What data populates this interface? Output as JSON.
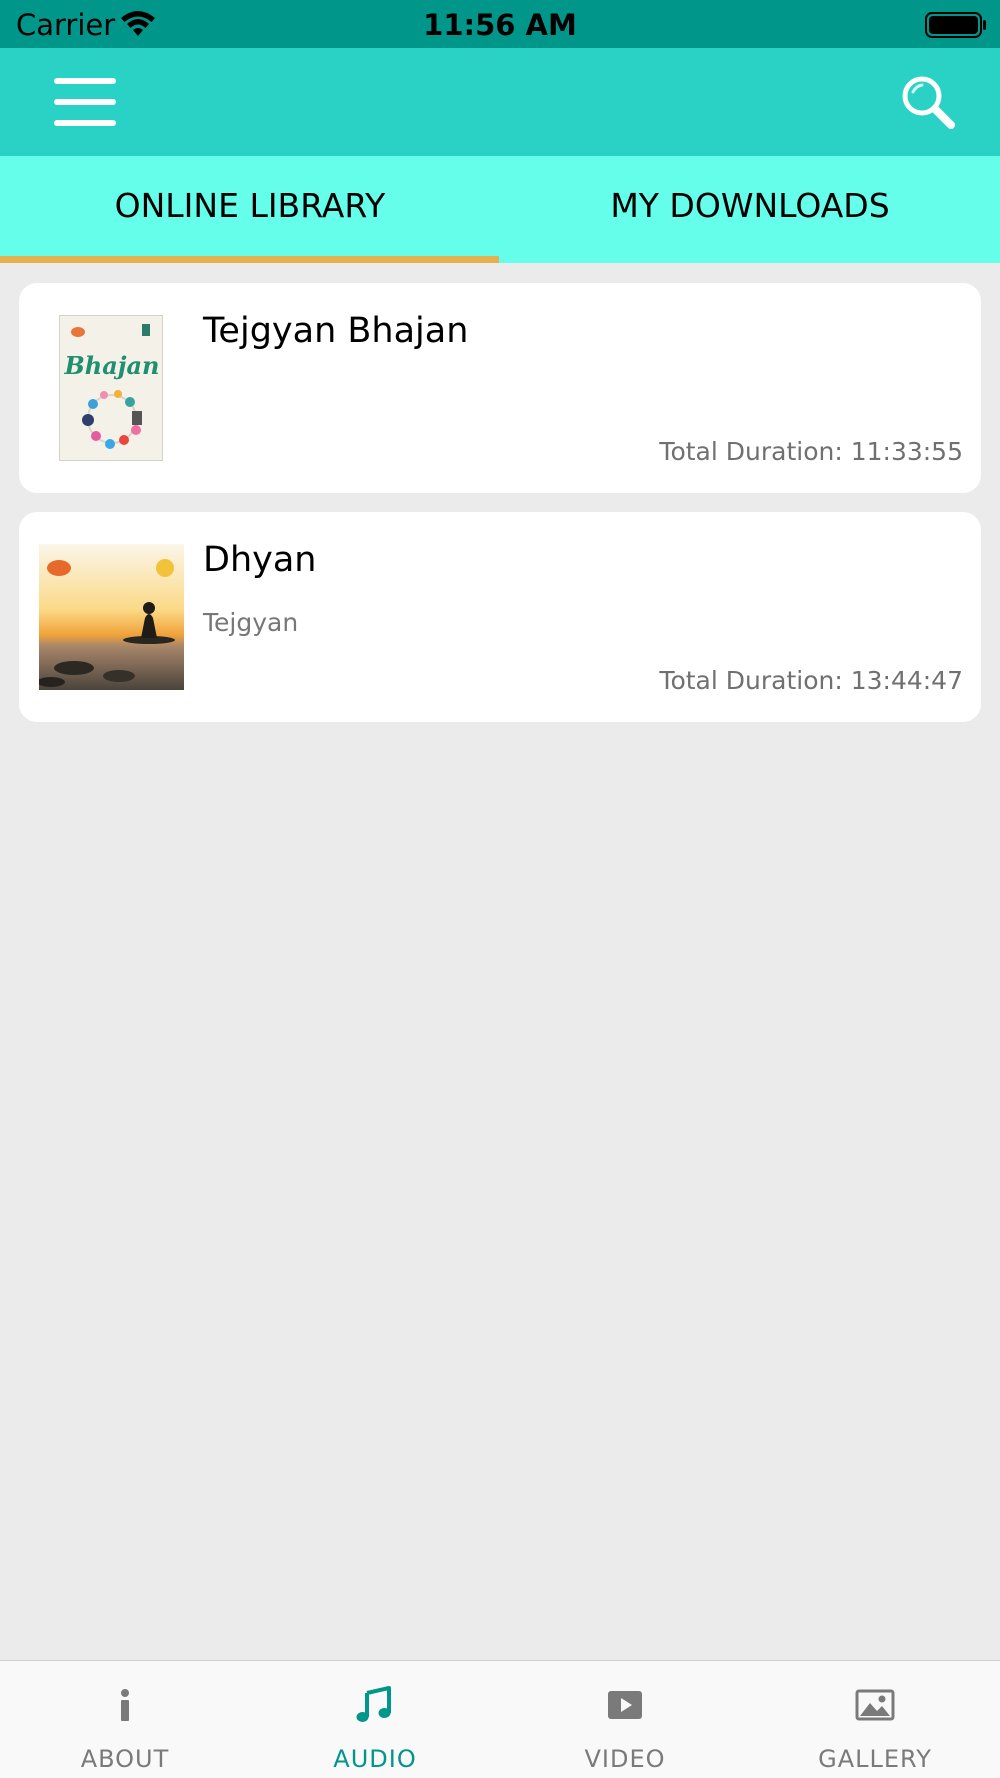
{
  "status_bar": {
    "carrier": "Carrier",
    "time": "11:56 AM",
    "icons": [
      "wifi-icon",
      "battery-icon"
    ]
  },
  "nav_bar": {
    "icons": [
      "menu-icon",
      "search-icon"
    ],
    "color": "#2ad2c5"
  },
  "tabs": {
    "items": [
      {
        "label": "ONLINE LIBRARY",
        "selected": true
      },
      {
        "label": "MY DOWNLOADS",
        "selected": false
      }
    ],
    "background": "#64feea",
    "indicator_color": "#e5b150"
  },
  "albums": [
    {
      "title": "Tejgyan Bhajan",
      "artist": "",
      "duration": "Total Duration: 11:33:55",
      "cover_text": "Bhajan"
    },
    {
      "title": "Dhyan",
      "artist": "Tejgyan",
      "duration": "Total Duration: 13:44:47"
    }
  ],
  "bottom_bar": {
    "items": [
      {
        "label": "ABOUT",
        "icon": "info-icon",
        "active": false
      },
      {
        "label": "AUDIO",
        "icon": "music-note-icon",
        "active": true
      },
      {
        "label": "VIDEO",
        "icon": "play-icon",
        "active": false
      },
      {
        "label": "GALLERY",
        "icon": "image-icon",
        "active": false
      }
    ],
    "active_color": "#00978a",
    "inactive_color": "#7a7a7a"
  }
}
